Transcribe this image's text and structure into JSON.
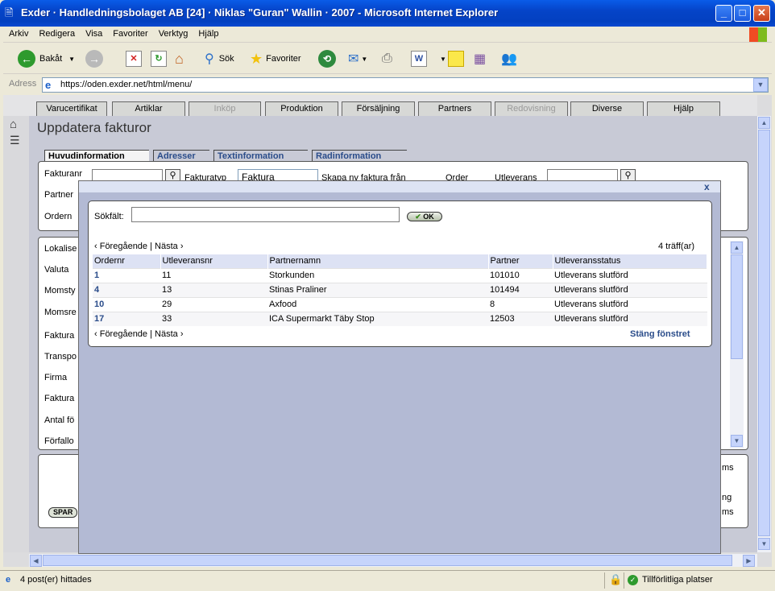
{
  "window": {
    "title": "Exder · Handledningsbolaget AB [24] · Niklas \"Guran\" Wallin · 2007 - Microsoft Internet Explorer",
    "app_icon": "ie-page-icon"
  },
  "menubar": {
    "items": [
      "Arkiv",
      "Redigera",
      "Visa",
      "Favoriter",
      "Verktyg",
      "Hjälp"
    ]
  },
  "toolbar": {
    "back_label": "Bakåt",
    "search_label": "Sök",
    "favorites_label": "Favoriter"
  },
  "address": {
    "label": "Adress",
    "url": "https://oden.exder.net/html/menu/"
  },
  "nav_tabs": [
    "Varucertifikat",
    "Artiklar",
    "Inköp",
    "Produktion",
    "Försäljning",
    "Partners",
    "Redovisning",
    "Diverse",
    "Hjälp"
  ],
  "page": {
    "title": "Uppdatera fakturor",
    "sub_tabs": [
      "Huvudinformation",
      "Adresser",
      "Textinformation",
      "Radinformation"
    ],
    "form_labels": {
      "fakturanr": "Fakturanr",
      "fakturatyp": "Fakturatyp",
      "fakturatyp_value": "Faktura",
      "skapa": "Skapa ny faktura från",
      "order": "Order",
      "utleverans": "Utleverans",
      "partner": "Partner",
      "ordernr": "Ordern"
    },
    "left_labels": [
      "Lokalise",
      "Valuta",
      "Momsty",
      "Momsre",
      "Faktura",
      "Transpo",
      "Firma",
      "Faktura",
      "Antal fö",
      "Förfallo"
    ],
    "bottom_button": "SPAR",
    "right_labels": [
      "ms",
      "ng",
      "ms"
    ]
  },
  "dialog": {
    "close_x": "x",
    "search_label": "Sökfält:",
    "search_value": "",
    "ok_label": "OK",
    "prev_label": "‹ Föregående",
    "separator": "|",
    "next_label": "Nästa ›",
    "hits": "4 träff(ar)",
    "close_window": "Stäng fönstret",
    "columns": [
      "Ordernr",
      "Utleveransnr",
      "Partnernamn",
      "Partner",
      "Utleveransstatus"
    ],
    "rows": [
      [
        "1",
        "11",
        "Storkunden",
        "101010",
        "Utleverans slutförd"
      ],
      [
        "4",
        "13",
        "Stinas Praliner",
        "101494",
        "Utleverans slutförd"
      ],
      [
        "10",
        "29",
        "Axfood",
        "8",
        "Utleverans slutförd"
      ],
      [
        "17",
        "33",
        "ICA Supermarkt Täby Stop",
        "12503",
        "Utleverans slutförd"
      ]
    ]
  },
  "status": {
    "text": "4 post(er) hittades",
    "zone": "Tillförlitliga platser"
  },
  "colors": {
    "link": "#2a4c8a",
    "overlay": "#b3bad4",
    "title_bar": "#0544c8"
  }
}
